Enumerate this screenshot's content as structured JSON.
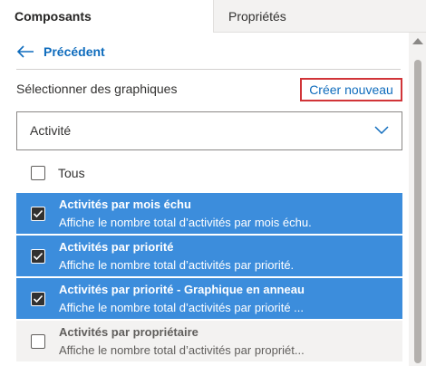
{
  "tabs": [
    {
      "label": "Composants",
      "active": true
    },
    {
      "label": "Propriétés",
      "active": false
    }
  ],
  "nav": {
    "back_label": "Précédent"
  },
  "section": {
    "label": "Sélectionner des graphiques",
    "create_label": "Créer nouveau"
  },
  "dropdown": {
    "selected": "Activité"
  },
  "all": {
    "label": "Tous",
    "checked": false
  },
  "charts": [
    {
      "title": "Activités par mois échu",
      "description": "Affiche le nombre total d’activités par mois échu.",
      "checked": true
    },
    {
      "title": "Activités par priorité",
      "description": "Affiche le nombre total d’activités par priorité.",
      "checked": true
    },
    {
      "title": "Activités par priorité - Graphique en anneau",
      "description": "Affiche le nombre total d’activités par priorité ...",
      "checked": true
    },
    {
      "title": "Activités par propriétaire",
      "description": "Affiche le nombre total d’activités par propriét...",
      "checked": false
    }
  ],
  "colors": {
    "accent": "#0f6cbd",
    "selected_row": "#3c8ddc",
    "highlight_border": "#d13438"
  }
}
